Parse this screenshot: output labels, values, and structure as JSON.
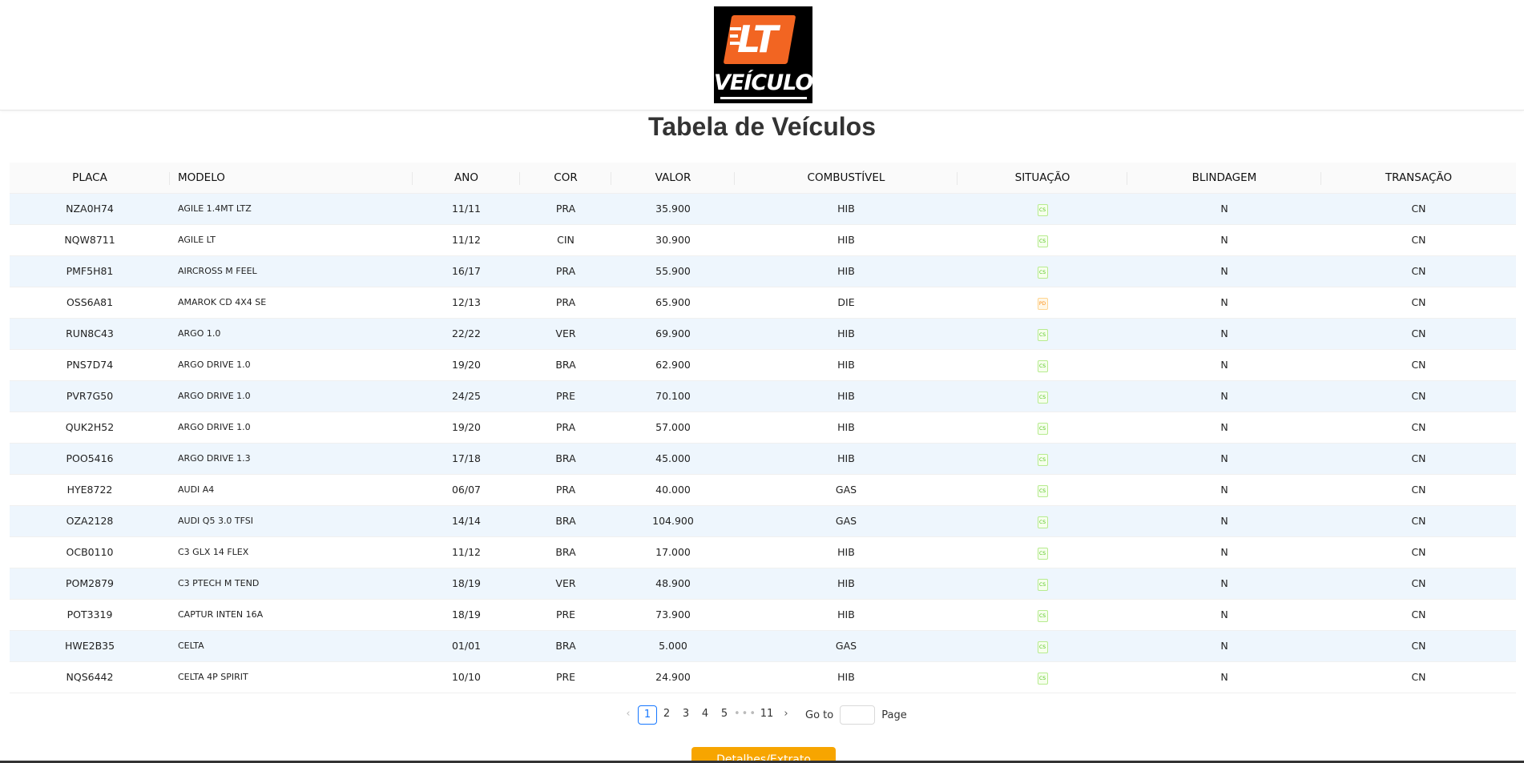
{
  "logo": {
    "line1": "LT",
    "line2": "VEÍCULOS"
  },
  "page_title": "Tabela de Veículos",
  "table": {
    "columns": [
      "PLACA",
      "MODELO",
      "ANO",
      "COR",
      "VALOR",
      "COMBUSTÍVEL",
      "SITUAÇÃO",
      "BLINDAGEM",
      "TRANSAÇÃO"
    ],
    "rows": [
      {
        "placa": "NZA0H74",
        "modelo": "AGILE 1.4MT LTZ",
        "ano": "11/11",
        "cor": "PRA",
        "valor": "35.900",
        "combustivel": "HIB",
        "situacao": "CS",
        "blindagem": "N",
        "transacao": "CN"
      },
      {
        "placa": "NQW8711",
        "modelo": "AGILE LT",
        "ano": "11/12",
        "cor": "CIN",
        "valor": "30.900",
        "combustivel": "HIB",
        "situacao": "CS",
        "blindagem": "N",
        "transacao": "CN"
      },
      {
        "placa": "PMF5H81",
        "modelo": "AIRCROSS M FEEL",
        "ano": "16/17",
        "cor": "PRA",
        "valor": "55.900",
        "combustivel": "HIB",
        "situacao": "CS",
        "blindagem": "N",
        "transacao": "CN"
      },
      {
        "placa": "OSS6A81",
        "modelo": "AMAROK CD 4X4 SE",
        "ano": "12/13",
        "cor": "PRA",
        "valor": "65.900",
        "combustivel": "DIE",
        "situacao": "PD",
        "blindagem": "N",
        "transacao": "CN"
      },
      {
        "placa": "RUN8C43",
        "modelo": "ARGO 1.0",
        "ano": "22/22",
        "cor": "VER",
        "valor": "69.900",
        "combustivel": "HIB",
        "situacao": "CS",
        "blindagem": "N",
        "transacao": "CN"
      },
      {
        "placa": "PNS7D74",
        "modelo": "ARGO DRIVE 1.0",
        "ano": "19/20",
        "cor": "BRA",
        "valor": "62.900",
        "combustivel": "HIB",
        "situacao": "CS",
        "blindagem": "N",
        "transacao": "CN"
      },
      {
        "placa": "PVR7G50",
        "modelo": "ARGO DRIVE 1.0",
        "ano": "24/25",
        "cor": "PRE",
        "valor": "70.100",
        "combustivel": "HIB",
        "situacao": "CS",
        "blindagem": "N",
        "transacao": "CN"
      },
      {
        "placa": "QUK2H52",
        "modelo": "ARGO DRIVE 1.0",
        "ano": "19/20",
        "cor": "PRA",
        "valor": "57.000",
        "combustivel": "HIB",
        "situacao": "CS",
        "blindagem": "N",
        "transacao": "CN"
      },
      {
        "placa": "POO5416",
        "modelo": "ARGO DRIVE 1.3",
        "ano": "17/18",
        "cor": "BRA",
        "valor": "45.000",
        "combustivel": "HIB",
        "situacao": "CS",
        "blindagem": "N",
        "transacao": "CN"
      },
      {
        "placa": "HYE8722",
        "modelo": "AUDI A4",
        "ano": "06/07",
        "cor": "PRA",
        "valor": "40.000",
        "combustivel": "GAS",
        "situacao": "CS",
        "blindagem": "N",
        "transacao": "CN"
      },
      {
        "placa": "OZA2128",
        "modelo": "AUDI Q5 3.0 TFSI",
        "ano": "14/14",
        "cor": "BRA",
        "valor": "104.900",
        "combustivel": "GAS",
        "situacao": "CS",
        "blindagem": "N",
        "transacao": "CN"
      },
      {
        "placa": "OCB0110",
        "modelo": "C3 GLX 14 FLEX",
        "ano": "11/12",
        "cor": "BRA",
        "valor": "17.000",
        "combustivel": "HIB",
        "situacao": "CS",
        "blindagem": "N",
        "transacao": "CN"
      },
      {
        "placa": "POM2879",
        "modelo": "C3 PTECH M TEND",
        "ano": "18/19",
        "cor": "VER",
        "valor": "48.900",
        "combustivel": "HIB",
        "situacao": "CS",
        "blindagem": "N",
        "transacao": "CN"
      },
      {
        "placa": "POT3319",
        "modelo": "CAPTUR INTEN 16A",
        "ano": "18/19",
        "cor": "PRE",
        "valor": "73.900",
        "combustivel": "HIB",
        "situacao": "CS",
        "blindagem": "N",
        "transacao": "CN"
      },
      {
        "placa": "HWE2B35",
        "modelo": "CELTA",
        "ano": "01/01",
        "cor": "BRA",
        "valor": "5.000",
        "combustivel": "GAS",
        "situacao": "CS",
        "blindagem": "N",
        "transacao": "CN"
      },
      {
        "placa": "NQS6442",
        "modelo": "CELTA 4P SPIRIT",
        "ano": "10/10",
        "cor": "PRE",
        "valor": "24.900",
        "combustivel": "HIB",
        "situacao": "CS",
        "blindagem": "N",
        "transacao": "CN"
      }
    ]
  },
  "pagination": {
    "prev_icon": "chevron-left-icon",
    "pages": [
      "1",
      "2",
      "3",
      "4",
      "5"
    ],
    "current": "1",
    "ellipsis": "•••",
    "last_page": "11",
    "next_icon": "chevron-right-icon",
    "goto_label": "Go to",
    "goto_value": "",
    "page_label": "Page"
  },
  "actions": {
    "detail_button": "Detalhes/Extrato"
  },
  "colors": {
    "accent": "#f7a500",
    "brand_orange": "#f26522",
    "row_stripe": "#eef6fd",
    "active_page": "#1677ff"
  }
}
